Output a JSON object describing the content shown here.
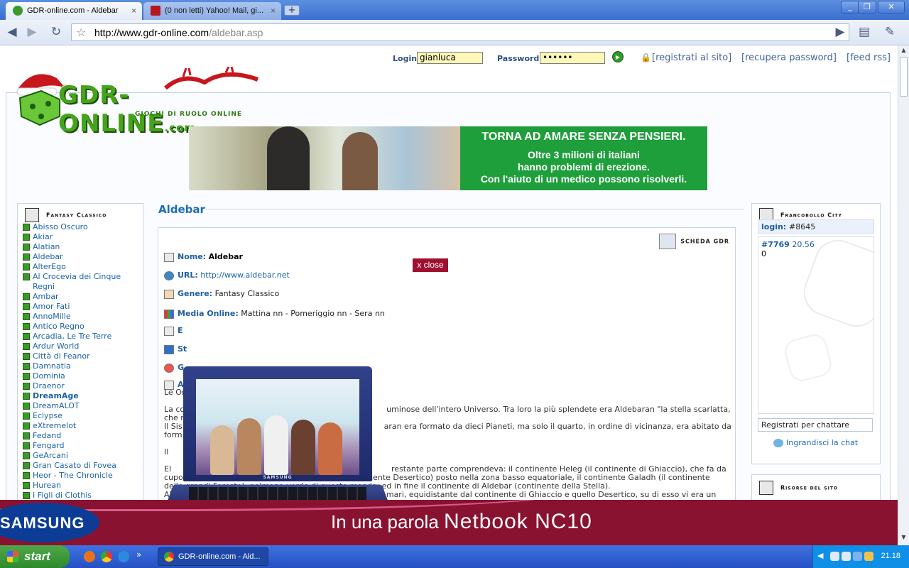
{
  "browser": {
    "tabs": [
      {
        "label": "GDR-online.com - Aldebar",
        "close": "×"
      },
      {
        "label": "(0 non letti) Yahoo! Mail, gi...",
        "close": "×"
      }
    ],
    "new_tab": "+",
    "window_buttons": [
      "_",
      "❐",
      "✕"
    ],
    "url_host": "http://www.gdr-online.com",
    "url_path": "/aldebar.asp"
  },
  "login": {
    "login_label": "Login",
    "login_value": "gianluca",
    "password_label": "Password",
    "password_value": "••••••",
    "register_link": "[registrati al sito]",
    "recover_link": "[recupera password]",
    "rss_link": "[feed rss]"
  },
  "logo": {
    "name": "GDR-ONLINE",
    "tld": ".com",
    "tagline": "GIOCHI DI RUOLO ONLINE"
  },
  "banner": {
    "headline": "TORNA AD AMARE SENZA PENSIERI.",
    "line1": "Oltre 3 milioni di italiani",
    "line2": "hanno problemi di erezione.",
    "line3": "Con l'aiuto di un medico possono risolverli."
  },
  "left_column": {
    "heading": "Fantasy Classico",
    "games": [
      {
        "name": "Abisso Oscuro",
        "bold": false
      },
      {
        "name": "Akiar",
        "bold": false
      },
      {
        "name": "Alatian",
        "bold": false
      },
      {
        "name": "Aldebar",
        "bold": false
      },
      {
        "name": "AlterEgo",
        "bold": false
      },
      {
        "name": "Al Crocevia dei Cinque Regni",
        "bold": false
      },
      {
        "name": "Ambar",
        "bold": false
      },
      {
        "name": "Amor Fati",
        "bold": false
      },
      {
        "name": "AnnoMille",
        "bold": false
      },
      {
        "name": "Antico Regno",
        "bold": false
      },
      {
        "name": "Arcadia, Le Tre Terre",
        "bold": false
      },
      {
        "name": "Ardur World",
        "bold": false
      },
      {
        "name": "Città di Feanor",
        "bold": false
      },
      {
        "name": "Damnatia",
        "bold": false
      },
      {
        "name": "Dominia",
        "bold": false
      },
      {
        "name": "Draenor",
        "bold": false
      },
      {
        "name": "DreamAge",
        "bold": true
      },
      {
        "name": "DreamALOT",
        "bold": false
      },
      {
        "name": "Eclypse",
        "bold": false
      },
      {
        "name": "eXtremelot",
        "bold": false
      },
      {
        "name": "Fedand",
        "bold": false
      },
      {
        "name": "Fengard",
        "bold": false
      },
      {
        "name": "GeArcani",
        "bold": false
      },
      {
        "name": "Gran Casato di Fovea",
        "bold": false
      },
      {
        "name": "Heor - The Chronicle",
        "bold": false
      },
      {
        "name": "Hurean",
        "bold": false
      },
      {
        "name": "I Figli di Clothis",
        "bold": false
      }
    ]
  },
  "center": {
    "title": "Aldebar",
    "scheda_label": "Scheda GDR",
    "name_label": "Nome:",
    "name_value": "Aldebar",
    "url_label": "URL:",
    "url_value": "http://www.aldebar.net",
    "genre_label": "Genere:",
    "genre_value": "Fantasy Classico",
    "media_label": "Media Online:",
    "media_value": "Mattina nn - Pomeriggio nn - Sera nn",
    "row5_label": "E",
    "row6_label": "St",
    "row7_label": "G",
    "row8_label": "A",
    "desc_lead": "Le Or",
    "desc_p1a": "La co",
    "desc_p1b": "uminose dell'intero Universo. Tra loro la più splendete era Aldebaran \"la stella scarlatta,",
    "desc_p1c": "che n",
    "desc_p2a": "Il Sis",
    "desc_p2b": "aran era formato da dieci Pianeti, ma solo il quarto, in ordine di vicinanza, era abitato da",
    "desc_p2c": "form",
    "desc_p3a": "Il",
    "desc_p4a": "El",
    "desc_p4b": "restante parte comprendeva: il continente Heleg (il continente di Ghiaccio), che fa da",
    "desc_p4c": "cupola al pianeta stesso, il continente Parch (il continente Desertico) posto nella zona basso equatoriale, il continente Galadh (il continente",
    "desc_p4d": "delle grandi Foreste), polmone verde di questo mondo, ed in fine il continente di Aldebar (continente della Stella).",
    "desc_p4e": "Aldebar era un continente che imponente emergeva dai mari, equidistante dal continente di Ghiaccio e quello Desertico, su di esso vi era un"
  },
  "popup": {
    "close_label": "x close"
  },
  "right_column": {
    "heading": "Francobollo City",
    "login_label": "login:",
    "login_id": "#8645",
    "chat_id": "#7769",
    "chat_time": "20.56",
    "chat_count": "0",
    "register_placeholder": "Registrati per chattare",
    "zoom_link": "Ingrandisci la chat",
    "resources_heading": "Risorse del sito"
  },
  "laptop_ad": {
    "brand": "SAMSUNG"
  },
  "samsung_banner": {
    "brand": "SAMSUNG",
    "slogan_small": "In una parola",
    "slogan_big": "Netbook NC10"
  },
  "taskbar": {
    "start": "start",
    "task_label": "GDR-online.com - Ald...",
    "clock": "21.18",
    "quick_more": "»"
  },
  "colors": {
    "brand_green": "#46a31c",
    "link_blue": "#1b62a8",
    "close_red": "#9f1030",
    "samsung_red": "#8a1231",
    "samsung_blue": "#0c3c95"
  }
}
